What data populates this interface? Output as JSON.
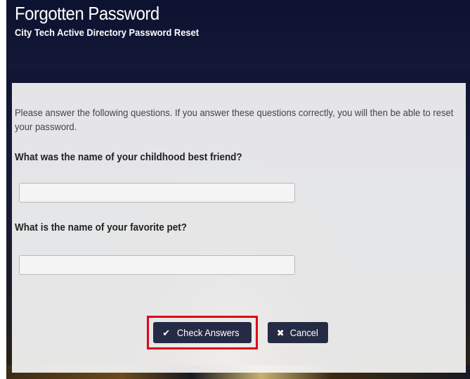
{
  "header": {
    "title": "Forgotten Password",
    "subtitle": "City Tech Active Directory Password Reset"
  },
  "form": {
    "intro": "Please answer the following questions. If you answer these questions correctly, you will then be able to reset your password.",
    "questions": [
      {
        "label": "What was the name of your childhood best friend?",
        "value": ""
      },
      {
        "label": "What is the name of your favorite pet?",
        "value": ""
      }
    ]
  },
  "buttons": {
    "check_icon": "✔",
    "check_label": "Check Answers",
    "cancel_icon": "✖",
    "cancel_label": "Cancel"
  },
  "colors": {
    "header_bg": "#0e1231",
    "button_bg": "#252a45",
    "highlight": "#e0001a"
  }
}
